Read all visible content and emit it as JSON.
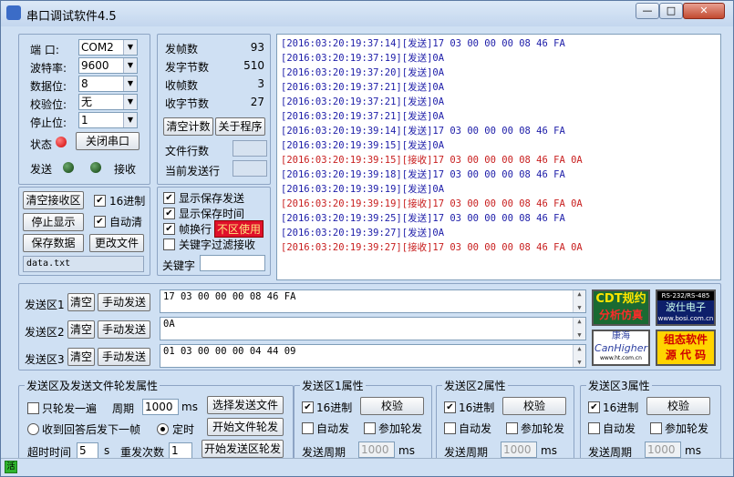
{
  "window": {
    "title": "串口调试软件4.5",
    "min": "—",
    "max": "□",
    "close": "✕"
  },
  "port": {
    "port_label": "端  口:",
    "port_value": "COM2",
    "baud_label": "波特率:",
    "baud_value": "9600",
    "data_label": "数据位:",
    "data_value": "8",
    "parity_label": "校验位:",
    "parity_value": "无",
    "stop_label": "停止位:",
    "stop_value": "1",
    "state_label": "状态",
    "close_port": "关闭串口",
    "send_label": "发送",
    "recv_label": "接收"
  },
  "stats": {
    "sent_frames_label": "发帧数",
    "sent_frames": "93",
    "sent_bytes_label": "发字节数",
    "sent_bytes": "510",
    "recv_frames_label": "收帧数",
    "recv_frames": "3",
    "recv_bytes_label": "收字节数",
    "recv_bytes": "27",
    "clear_count": "清空计数",
    "about": "关于程序",
    "file_lines_label": "文件行数",
    "current_line_label": "当前发送行"
  },
  "recv_ctrl": {
    "clear_recv": "清空接收区",
    "hex_label": "16进制",
    "stop_display": "停止显示",
    "auto_clear_label": "自动清",
    "save_data": "保存数据",
    "change_file": "更改文件",
    "file_name": "data.txt"
  },
  "display_opts": {
    "show_save_send": "显示保存发送",
    "show_save_time": "显示保存时间",
    "frame_newline": "帧换行",
    "frame_badge": "不区使用",
    "keyword_filter": "关键字过滤接收",
    "keyword_label": "关键字"
  },
  "log": [
    {
      "text": "[2016:03:20:19:37:14][发送]17 03 00 00 00 08 46 FA",
      "color": "#1c1ca8"
    },
    {
      "text": "[2016:03:20:19:37:19][发送]0A",
      "color": "#1c1ca8"
    },
    {
      "text": "[2016:03:20:19:37:20][发送]0A",
      "color": "#1c1ca8"
    },
    {
      "text": "[2016:03:20:19:37:21][发送]0A",
      "color": "#1c1ca8"
    },
    {
      "text": "[2016:03:20:19:37:21][发送]0A",
      "color": "#1c1ca8"
    },
    {
      "text": "[2016:03:20:19:37:21][发送]0A",
      "color": "#1c1ca8"
    },
    {
      "text": "[2016:03:20:19:39:14][发送]17 03 00 00 00 08 46 FA",
      "color": "#1c1ca8"
    },
    {
      "text": "[2016:03:20:19:39:15][发送]0A",
      "color": "#1c1ca8"
    },
    {
      "text": "[2016:03:20:19:39:15][接收]17 03 00 00 00 08 46 FA 0A",
      "color": "#c81e1e"
    },
    {
      "text": "[2016:03:20:19:39:18][发送]17 03 00 00 00 08 46 FA",
      "color": "#1c1ca8"
    },
    {
      "text": "[2016:03:20:19:39:19][发送]0A",
      "color": "#1c1ca8"
    },
    {
      "text": "[2016:03:20:19:39:19][接收]17 03 00 00 00 08 46 FA 0A",
      "color": "#c81e1e"
    },
    {
      "text": "[2016:03:20:19:39:25][发送]17 03 00 00 00 08 46 FA",
      "color": "#1c1ca8"
    },
    {
      "text": "[2016:03:20:19:39:27][发送]0A",
      "color": "#1c1ca8"
    },
    {
      "text": "[2016:03:20:19:39:27][接收]17 03 00 00 00 08 46 FA 0A",
      "color": "#c81e1e"
    }
  ],
  "send_areas": [
    {
      "label": "发送区1",
      "clear": "清空",
      "manual": "手动发送",
      "content": "17 03 00 00 00 08 46 FA"
    },
    {
      "label": "发送区2",
      "clear": "清空",
      "manual": "手动发送",
      "content": "0A"
    },
    {
      "label": "发送区3",
      "clear": "清空",
      "manual": "手动发送",
      "content": "01 03 00 00 00 04 44 09"
    }
  ],
  "banners": {
    "cdt_line1": "CDT规约",
    "cdt_line2": "分析仿真",
    "bosi_top": "RS-232/RS-485",
    "bosi_mid": "波仕电子",
    "bosi_url": "www.bosi.com.cn",
    "ht_cn": "康海",
    "ht_en": "CanHigher",
    "ht_url": "www.ht.com.cn",
    "src_line1": "组态软件",
    "src_line2": "源 代 码"
  },
  "poll": {
    "title": "发送区及发送文件轮发属性",
    "only_once": "只轮发一遍",
    "period_label": "周期",
    "period_value": "1000",
    "ms": "ms",
    "choose_file": "选择发送文件",
    "after_reply": "收到回答后发下一帧",
    "timed": "定时",
    "start_file": "开始文件轮发",
    "timeout_label": "超时时间",
    "timeout_value": "5",
    "s": "s",
    "resend_label": "重发次数",
    "resend_value": "1",
    "start_area": "开始发送区轮发"
  },
  "area_props": [
    {
      "title": "发送区1属性",
      "hex": "16进制",
      "verify": "校验",
      "auto_send": "自动发",
      "join_poll": "参加轮发",
      "period_label": "发送周期",
      "period_value": "1000",
      "ms": "ms"
    },
    {
      "title": "发送区2属性",
      "hex": "16进制",
      "verify": "校验",
      "auto_send": "自动发",
      "join_poll": "参加轮发",
      "period_label": "发送周期",
      "period_value": "1000",
      "ms": "ms"
    },
    {
      "title": "发送区3属性",
      "hex": "16进制",
      "verify": "校验",
      "auto_send": "自动发",
      "join_poll": "参加轮发",
      "period_label": "发送周期",
      "period_value": "1000",
      "ms": "ms"
    }
  ],
  "status": {
    "indicator": "活"
  }
}
